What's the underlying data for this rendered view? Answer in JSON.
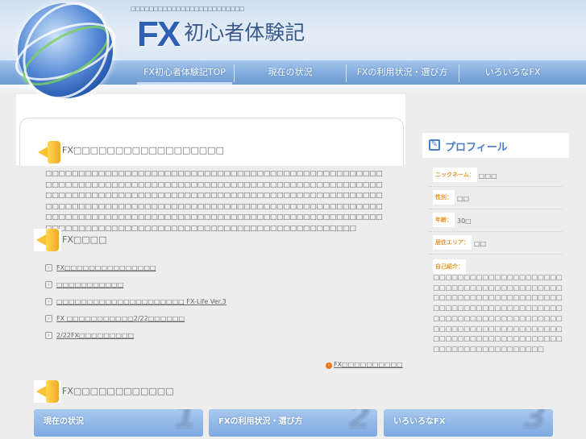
{
  "header": {
    "tagline": "□□□□□□□□□□□□□□□□□□□□□□□□□",
    "logo_fx": "FX",
    "logo_jp": "初心者体験記"
  },
  "nav": [
    {
      "label": "FX初心者体験記TOP"
    },
    {
      "label": "現在の状況"
    },
    {
      "label": "FXの利用状況・選び方"
    },
    {
      "label": "いろいろなFX"
    }
  ],
  "main": {
    "section1_title": "FX□□□□□□□□□□□□□□□□□□",
    "section1_body": "□□□□□□□□□□□□□□□□□□□□□□□□□□□□□□□□□□□□□□□□□□□□□□□□□□□□□□□□□□□□□□□□□□□□□□□□□□□□□□□□□□□□□□□□□□□□□□□□□□□□□□□□□□□□□□□□□□□□□□□□□□□□□□□□□□□□□□□□□□□□□□□□□□□□□□□□□□□□□□□□□□□□□□□□□□□□□□□□□□□□□□□□□□□□□□□□□□□□□□□□□□□□□□□□□□□□□□□□□□□□□□□□□□□□□□□□□□□□□□□□□□□□□□□□□□□□□□□□□□□□□□□□□□□□□□□□□□□□□□□□□□□□□□□□□□□□□□□□□□□□□□",
    "section2_title": "FX□□□□",
    "links": [
      "FX□□□□□□□□□□□□□□□",
      "□□□□□□□□□□□",
      "□□□□□□□□□□□□□□□□□□□□□ FX-Life Ver.3",
      "FX □□□□□□□□□□□2/22□□□□□□",
      "2/22FX□□□□□□□□□"
    ],
    "more_link": "FX□□□□□□□□□□",
    "section3_title": "FX□□□□□□□□□□□□",
    "cards": [
      {
        "label": "現在の状況",
        "num": "1"
      },
      {
        "label": "FXの利用状況・選び方",
        "num": "2"
      },
      {
        "label": "いろいろなFX",
        "num": "3"
      }
    ]
  },
  "profile": {
    "title": "プロフィール",
    "fields": [
      {
        "label": "ニックネーム：",
        "value": "□□□"
      },
      {
        "label": "性別：",
        "value": "□□"
      },
      {
        "label": "年齢：",
        "value": "30□"
      },
      {
        "label": "居住エリア：",
        "value": "□□"
      }
    ],
    "intro_label": "自己紹介：",
    "intro": "□□□□□□□□□□□□□□□□□□□□□□□□□□□□□□□□□□□□□□□□□□□□□□□□□□□□□□□□□□□□□□□□□□□□□□□□□□□□□□□□□□□□□□□□□□□□□□□□□□□□□□□□□□□□□□□□□□□□□□□□□□□□□□□□□□□□□□□□□□□□□□□□□□□□□□□□□□□□□□□□□□□□□"
  }
}
